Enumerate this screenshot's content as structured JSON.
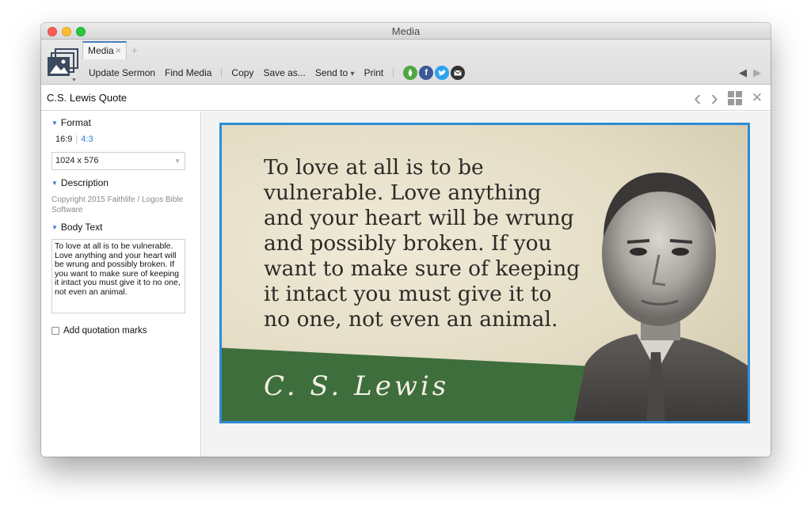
{
  "window": {
    "title": "Media"
  },
  "tabs": {
    "active_label": "Media",
    "close_glyph": "×",
    "add_glyph": "+"
  },
  "toolbar": {
    "update_sermon": "Update Sermon",
    "find_media": "Find Media",
    "copy": "Copy",
    "save_as": "Save as...",
    "send_to": "Send to",
    "send_to_caret": "▾",
    "print": "Print",
    "social": [
      {
        "icon": "faithlife-icon",
        "color": "#4fa843",
        "glyph": "●"
      },
      {
        "icon": "facebook-icon",
        "color": "#3b5998",
        "glyph": "f"
      },
      {
        "icon": "twitter-icon",
        "color": "#2aa3ef",
        "glyph": "t"
      },
      {
        "icon": "email-icon",
        "color": "#333333",
        "glyph": "✉"
      }
    ],
    "back_glyph": "◀",
    "forward_glyph": "▶"
  },
  "panel": {
    "title": "C.S. Lewis Quote",
    "prev_glyph": "‹",
    "next_glyph": "›",
    "close_glyph": "✕"
  },
  "sidebar": {
    "format": {
      "heading": "Format",
      "ratio_active": "16:9",
      "ratio_sep": "|",
      "ratio_alt": "4:3",
      "size_value": "1024 x 576"
    },
    "description": {
      "heading": "Description",
      "text": "Copyright 2015 Faithlife / Logos Bible Software"
    },
    "body_text": {
      "heading": "Body Text",
      "value": "To love at all is to be vulnerable. Love anything and your heart will be wrung and possibly broken. If you want to make sure of keeping it intact you must give it to no one, not even an animal."
    },
    "quotation_marks": {
      "label": "Add quotation marks",
      "checked": false
    }
  },
  "media": {
    "quote_lines": [
      "To love at all is to be",
      "vulnerable. Love anything",
      "and your heart will be wrung",
      "and possibly broken. If you",
      "want to make sure of keeping",
      "it intact you must give it to",
      "no one, not even an animal."
    ],
    "signature": "C. S. Lewis",
    "colors": {
      "accent_border": "#2e8cd6",
      "band_green": "#3e6e3c",
      "parchment": "#e6dfc8"
    }
  }
}
